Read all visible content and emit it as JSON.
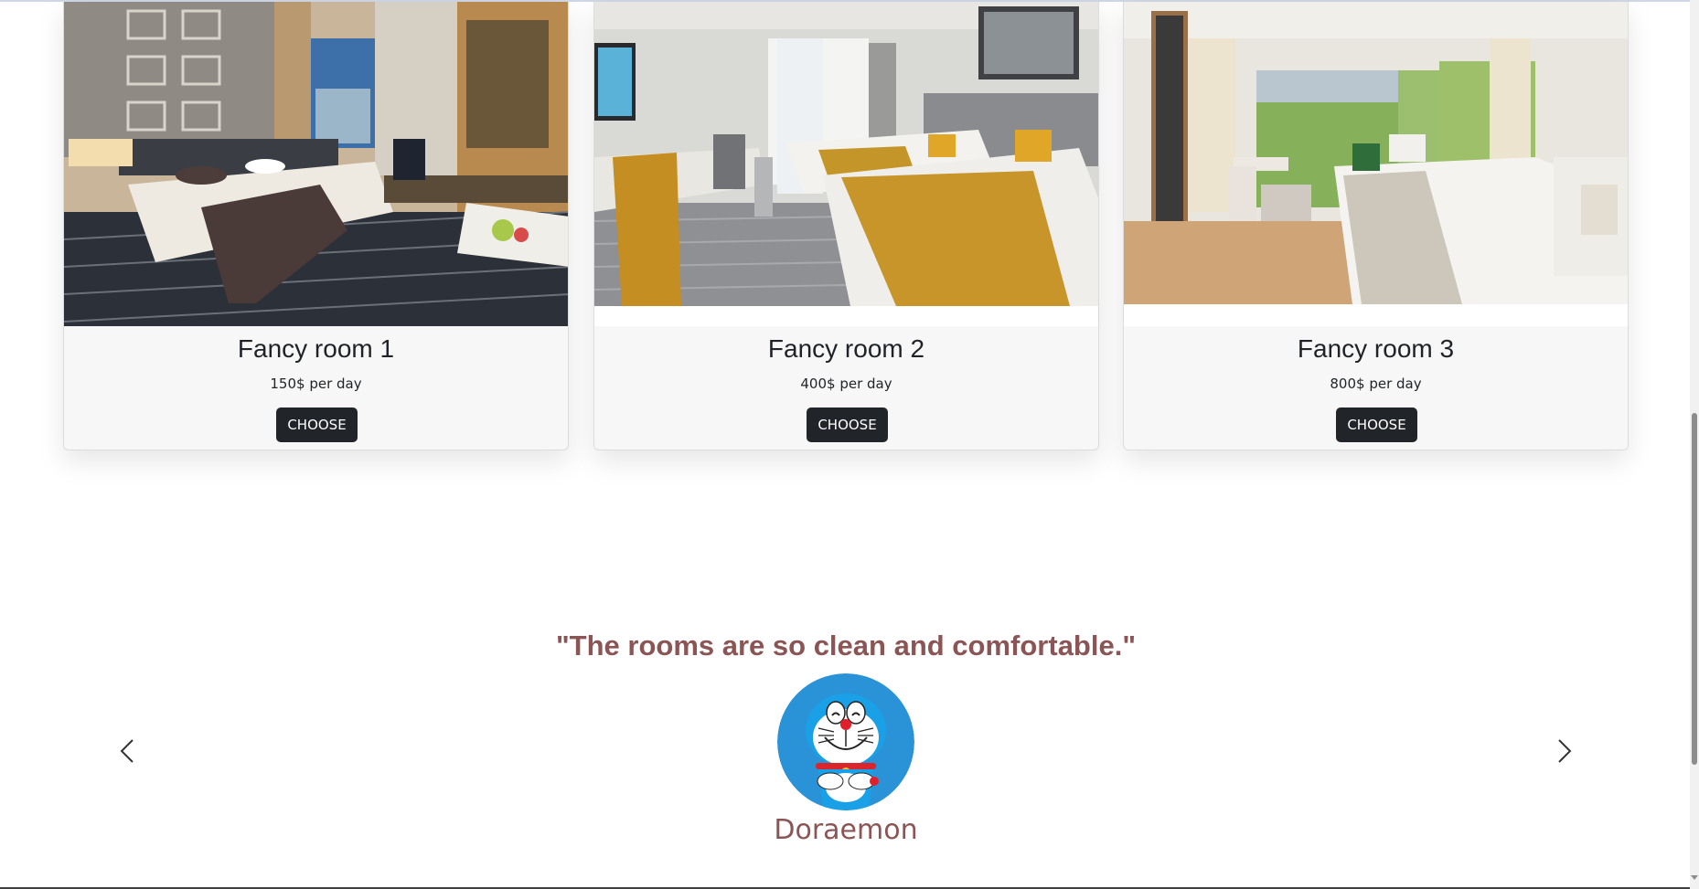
{
  "rooms": [
    {
      "title": "Fancy room 1",
      "price": "150$ per day",
      "button": "CHOOSE"
    },
    {
      "title": "Fancy room 2",
      "price": "400$ per day",
      "button": "CHOOSE"
    },
    {
      "title": "Fancy room 3",
      "price": "800$ per day",
      "button": "CHOOSE"
    }
  ],
  "testimonial": {
    "quote": "\"The rooms are so clean and comfortable.\"",
    "name": "Doraemon"
  },
  "icons": {
    "prev": "chevron-left-icon",
    "next": "chevron-right-icon"
  },
  "colors": {
    "accent": "#8b5555",
    "button_bg": "#212529",
    "button_text": "#ffffff",
    "card_bg": "#f7f7f7"
  }
}
